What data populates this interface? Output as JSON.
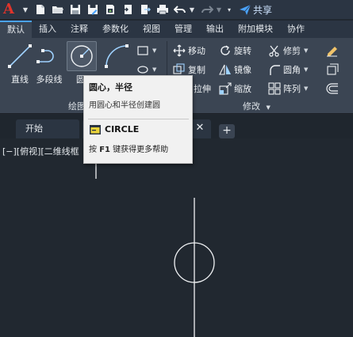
{
  "app": {
    "logo_letter": "A",
    "share_label": "共享",
    "quick_access_icons": [
      "new-file-icon",
      "open-folder-icon",
      "save-icon",
      "save-as-icon",
      "plot-icon",
      "import-icon",
      "export-icon",
      "print-icon",
      "undo-icon",
      "redo-icon"
    ]
  },
  "ribbon": {
    "tabs": [
      "默认",
      "插入",
      "注释",
      "参数化",
      "视图",
      "管理",
      "输出",
      "附加模块",
      "协作"
    ],
    "active_tab": "默认",
    "draw_panel": {
      "title": "绘图",
      "line_label": "直线",
      "polyline_label": "多段线",
      "circle_label": "圆"
    },
    "modify_panel": {
      "title": "修改",
      "move_label": "移动",
      "rotate_label": "旋转",
      "trim_label": "修剪",
      "copy_label": "复制",
      "mirror_label": "镜像",
      "fillet_label": "圆角",
      "stretch_label": "拉伸",
      "scale_label": "缩放",
      "array_label": "阵列"
    }
  },
  "file_tabs": {
    "home_label": "开始",
    "close_glyph": "✕",
    "add_glyph": "+"
  },
  "canvas": {
    "viewport_control": "[−][俯视][二维线框"
  },
  "tooltip": {
    "title": "圆心，半径",
    "description": "用圆心和半径创建圆",
    "command": "CIRCLE",
    "help_prefix": "按",
    "help_key": "F1",
    "help_suffix": "键获得更多帮助"
  },
  "colors": {
    "canvas_bg": "#212830",
    "ribbon_bg": "#3b4553",
    "tab_bar_bg": "#2b3543",
    "accent_blue": "#4aa3ff",
    "logo_red": "#e0342b",
    "tooltip_bg": "#f1f1f1"
  }
}
